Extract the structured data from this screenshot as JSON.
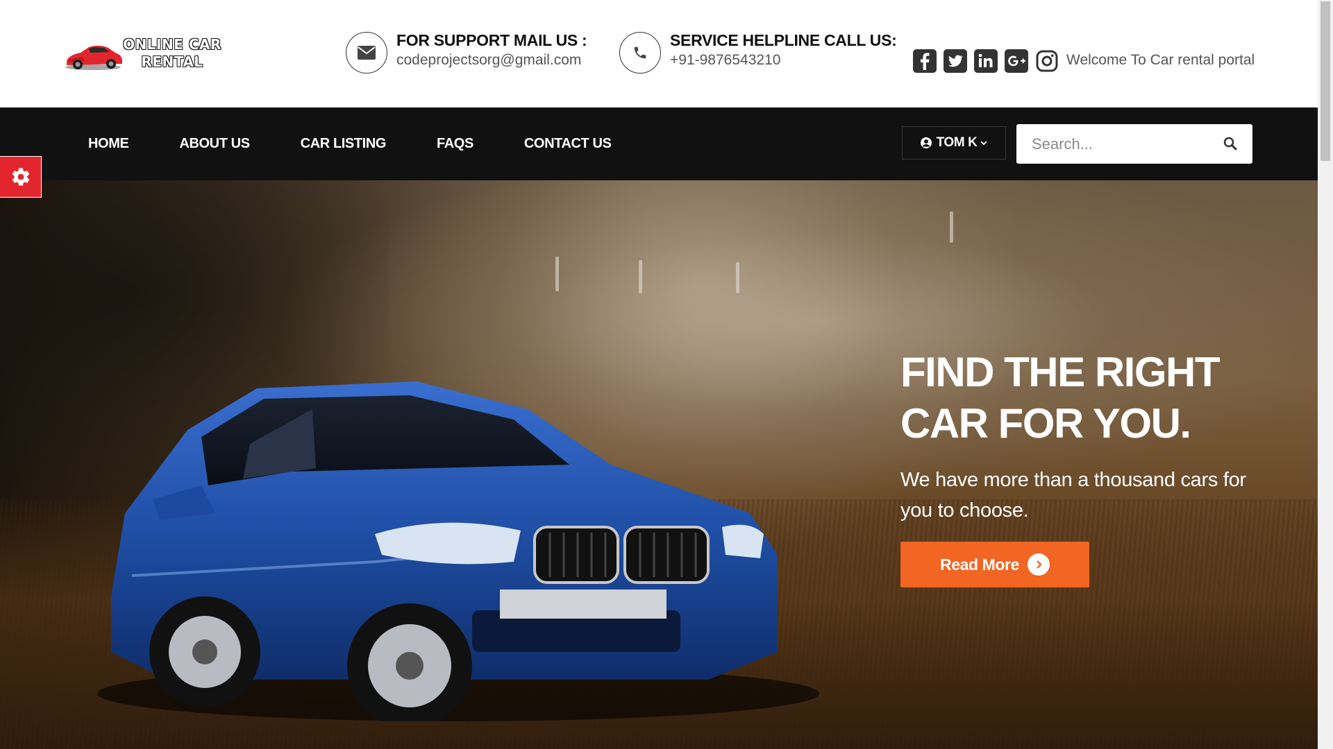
{
  "brand": {
    "logo_line1": "ONLINE CAR",
    "logo_line2": "RENTAL",
    "car_color": "#e3262e"
  },
  "header": {
    "support": {
      "icon": "envelope-icon",
      "title": "FOR SUPPORT MAIL US :",
      "value": "codeprojectsorg@gmail.com"
    },
    "helpline": {
      "icon": "phone-icon",
      "title": "SERVICE HELPLINE CALL US:",
      "value": "+91-9876543210"
    },
    "socials": [
      "facebook-icon",
      "twitter-icon",
      "linkedin-icon",
      "google-plus-icon",
      "instagram-icon"
    ],
    "welcome": "Welcome To Car rental portal"
  },
  "nav": {
    "items": [
      "HOME",
      "ABOUT US",
      "CAR LISTING",
      "FAQS",
      "CONTACT US"
    ],
    "user_label": "TOM K",
    "search_placeholder": "Search..."
  },
  "hero": {
    "title_line1": "FIND THE RIGHT",
    "title_line2": "CAR FOR YOU.",
    "subtitle": "We have more than a thousand cars for you to choose.",
    "cta_label": "Read More",
    "cta_color": "#f26522"
  },
  "colors": {
    "navbar": "#111111",
    "settings_tab": "#e3262e",
    "car_body": "#1f4fa6"
  }
}
